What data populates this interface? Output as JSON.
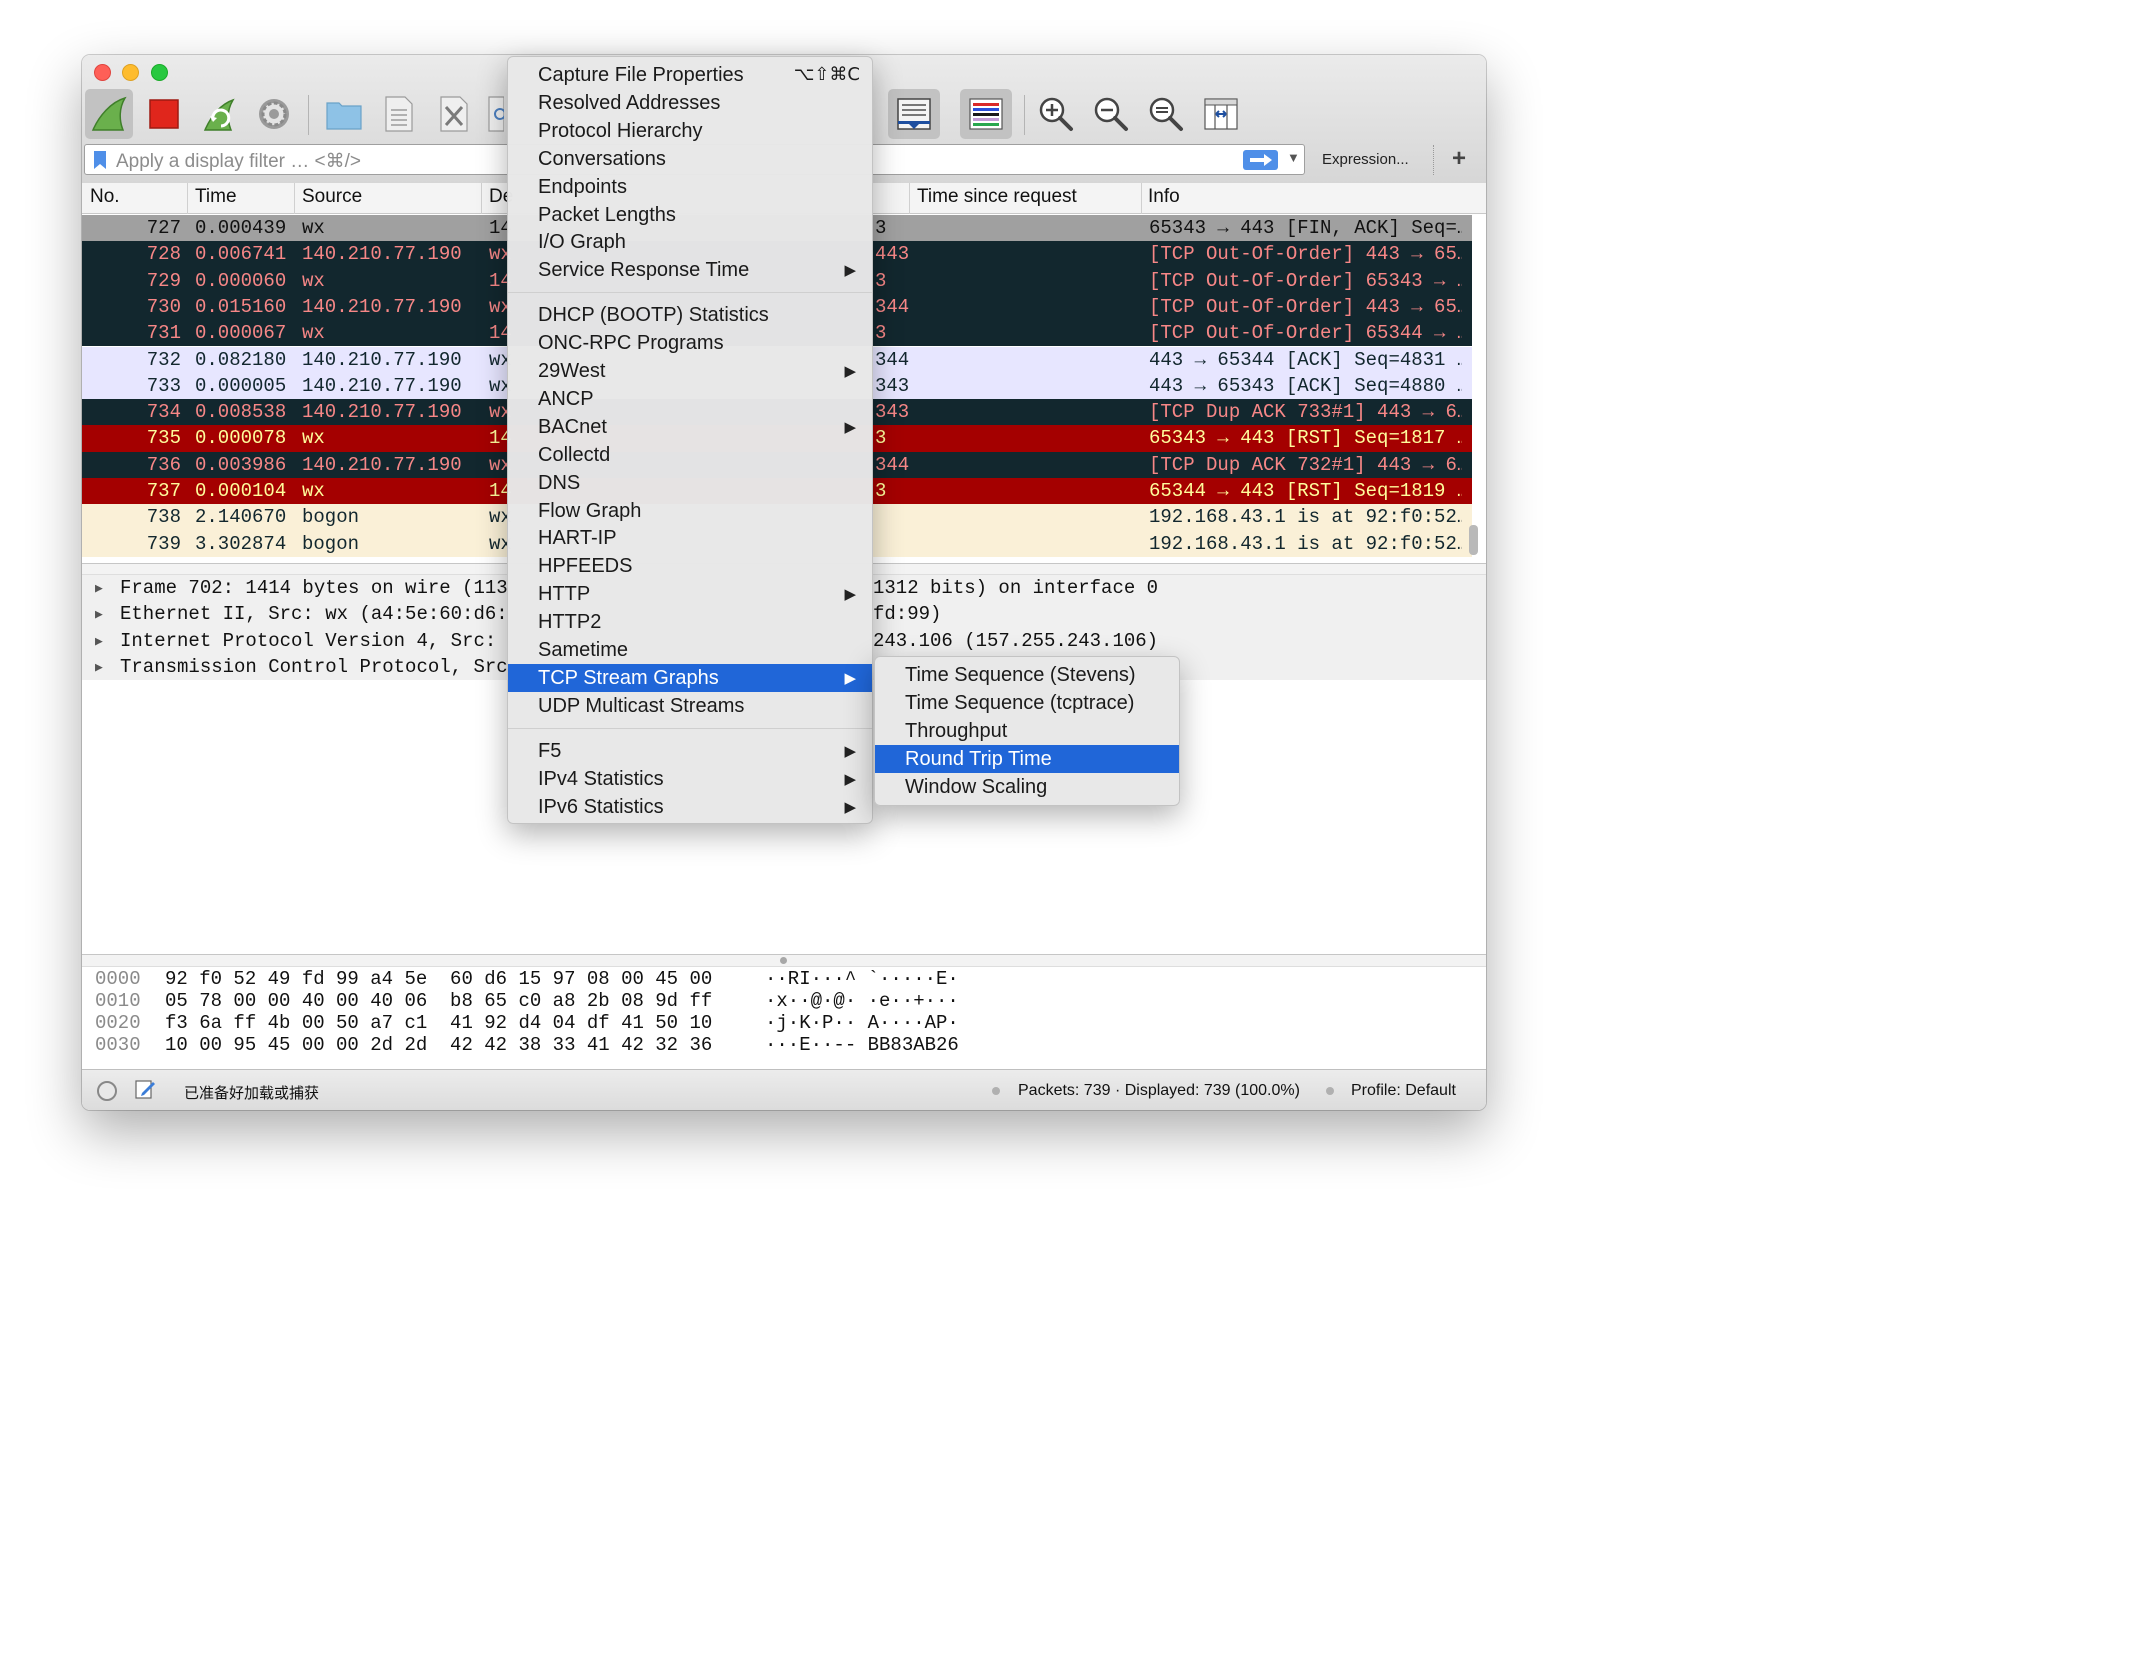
{
  "toolbar": {
    "icons": [
      "shark-fin-start-icon",
      "stop-capture-icon",
      "restart-capture-icon",
      "capture-options-icon",
      "open-file-icon",
      "save-file-icon",
      "close-file-icon",
      "reload-file-icon",
      "auto-scroll-icon",
      "colorize-icon",
      "zoom-in-icon",
      "zoom-out-icon",
      "zoom-normal-icon",
      "resize-columns-icon"
    ],
    "expression_label": "Expression...",
    "add_label": "+"
  },
  "filter": {
    "placeholder": "Apply a display filter … <⌘/>"
  },
  "columns": {
    "no": "No.",
    "time": "Time",
    "source": "Source",
    "destination": "De",
    "time_since_request": "Time since request",
    "info": "Info"
  },
  "packets": [
    {
      "no": "727",
      "time": "0.000439",
      "source": "wx",
      "dest": "14",
      "dest2": "3",
      "info": "65343 → 443 [FIN, ACK] Seq=…"
    },
    {
      "no": "728",
      "time": "0.006741",
      "source": "140.210.77.190",
      "dest": "wx",
      "dest2": "443",
      "info": "[TCP Out-Of-Order] 443 → 65…"
    },
    {
      "no": "729",
      "time": "0.000060",
      "source": "wx",
      "dest": "14",
      "dest2": "3",
      "info": "[TCP Out-Of-Order] 65343 → …"
    },
    {
      "no": "730",
      "time": "0.015160",
      "source": "140.210.77.190",
      "dest": "wx",
      "dest2": "344",
      "info": "[TCP Out-Of-Order] 443 → 65…"
    },
    {
      "no": "731",
      "time": "0.000067",
      "source": "wx",
      "dest": "14",
      "dest2": "3",
      "info": "[TCP Out-Of-Order] 65344 → …"
    },
    {
      "no": "732",
      "time": "0.082180",
      "source": "140.210.77.190",
      "dest": "wx",
      "dest2": "344",
      "info": "443 → 65344 [ACK] Seq=4831 …"
    },
    {
      "no": "733",
      "time": "0.000005",
      "source": "140.210.77.190",
      "dest": "wx",
      "dest2": "343",
      "info": "443 → 65343 [ACK] Seq=4880 …"
    },
    {
      "no": "734",
      "time": "0.008538",
      "source": "140.210.77.190",
      "dest": "wx",
      "dest2": "343",
      "info": "[TCP Dup ACK 733#1] 443 → 6…"
    },
    {
      "no": "735",
      "time": "0.000078",
      "source": "wx",
      "dest": "14",
      "dest2": "3",
      "info": "65343 → 443 [RST] Seq=1817 …"
    },
    {
      "no": "736",
      "time": "0.003986",
      "source": "140.210.77.190",
      "dest": "wx",
      "dest2": "344",
      "info": "[TCP Dup ACK 732#1] 443 → 6…"
    },
    {
      "no": "737",
      "time": "0.000104",
      "source": "wx",
      "dest": "14",
      "dest2": "3",
      "info": "65344 → 443 [RST] Seq=1819 …"
    },
    {
      "no": "738",
      "time": "2.140670",
      "source": "bogon",
      "dest": "wx",
      "dest2": "",
      "info": "192.168.43.1 is at 92:f0:52…"
    },
    {
      "no": "739",
      "time": "3.302874",
      "source": "bogon",
      "dest": "wx",
      "dest2": "",
      "info": "192.168.43.1 is at 92:f0:52…"
    }
  ],
  "row_styles": [
    {
      "bg": "#a0a0a0",
      "fg": "#111111"
    },
    {
      "bg": "#12272e",
      "fg": "#f78787"
    },
    {
      "bg": "#12272e",
      "fg": "#f78787"
    },
    {
      "bg": "#12272e",
      "fg": "#f78787"
    },
    {
      "bg": "#12272e",
      "fg": "#f78787"
    },
    {
      "bg": "#e7e6ff",
      "fg": "#12272e"
    },
    {
      "bg": "#e7e6ff",
      "fg": "#12272e"
    },
    {
      "bg": "#12272e",
      "fg": "#f78787"
    },
    {
      "bg": "#a40000",
      "fg": "#fffc9c"
    },
    {
      "bg": "#12272e",
      "fg": "#f78787"
    },
    {
      "bg": "#a40000",
      "fg": "#fffc9c"
    },
    {
      "bg": "#faf0d7",
      "fg": "#12272e"
    },
    {
      "bg": "#faf0d7",
      "fg": "#12272e"
    }
  ],
  "details": [
    {
      "left": "Frame 702: 1414 bytes on wire (113",
      "right": "1312 bits) on interface 0"
    },
    {
      "left": "Ethernet II, Src: wx (a4:5e:60:d6:",
      "right": "fd:99)"
    },
    {
      "left": "Internet Protocol Version 4, Src: ",
      "right": "243.106 (157.255.243.106)"
    },
    {
      "left": "Transmission Control Protocol, Src",
      "right": ""
    }
  ],
  "bytes": [
    {
      "offset": "0000",
      "hex": "92 f0 52 49 fd 99 a4 5e  60 d6 15 97 08 00 45 00",
      "ascii": "··RI···^ `·····E·"
    },
    {
      "offset": "0010",
      "hex": "05 78 00 00 40 00 40 06  b8 65 c0 a8 2b 08 9d ff",
      "ascii": "·x··@·@· ·e··+···"
    },
    {
      "offset": "0020",
      "hex": "f3 6a ff 4b 00 50 a7 c1  41 92 d4 04 df 41 50 10",
      "ascii": "·j·K·P·· A····AP·"
    },
    {
      "offset": "0030",
      "hex": "10 00 95 45 00 00 2d 2d  42 42 38 33 41 42 32 36",
      "ascii": "···E··-- BB83AB26"
    }
  ],
  "status": {
    "message": "已准备好加载或捕获",
    "packets": "Packets: 739 · Displayed: 739 (100.0%)",
    "profile": "Profile: Default"
  },
  "statistics_menu": {
    "items": [
      {
        "label": "Capture File Properties",
        "shortcut": "⌥⇧⌘C",
        "submenu": false
      },
      {
        "label": "Resolved Addresses",
        "submenu": false
      },
      {
        "label": "Protocol Hierarchy",
        "submenu": false
      },
      {
        "label": "Conversations",
        "submenu": false
      },
      {
        "label": "Endpoints",
        "submenu": false
      },
      {
        "label": "Packet Lengths",
        "submenu": false
      },
      {
        "label": "I/O Graph",
        "submenu": false
      },
      {
        "label": "Service Response Time",
        "submenu": true
      },
      {
        "separator": true
      },
      {
        "label": "DHCP (BOOTP) Statistics",
        "submenu": false
      },
      {
        "label": "ONC-RPC Programs",
        "submenu": false
      },
      {
        "label": "29West",
        "submenu": true
      },
      {
        "label": "ANCP",
        "submenu": false
      },
      {
        "label": "BACnet",
        "submenu": true
      },
      {
        "label": "Collectd",
        "submenu": false
      },
      {
        "label": "DNS",
        "submenu": false
      },
      {
        "label": "Flow Graph",
        "submenu": false
      },
      {
        "label": "HART-IP",
        "submenu": false
      },
      {
        "label": "HPFEEDS",
        "submenu": false
      },
      {
        "label": "HTTP",
        "submenu": true
      },
      {
        "label": "HTTP2",
        "submenu": false
      },
      {
        "label": "Sametime",
        "submenu": false
      },
      {
        "label": "TCP Stream Graphs",
        "submenu": true,
        "highlighted": true
      },
      {
        "label": "UDP Multicast Streams",
        "submenu": false
      },
      {
        "separator": true
      },
      {
        "label": "F5",
        "submenu": true
      },
      {
        "label": "IPv4 Statistics",
        "submenu": true
      },
      {
        "label": "IPv6 Statistics",
        "submenu": true
      }
    ]
  },
  "tcp_stream_graphs_submenu": {
    "items": [
      {
        "label": "Time Sequence (Stevens)"
      },
      {
        "label": "Time Sequence (tcptrace)"
      },
      {
        "label": "Throughput"
      },
      {
        "label": "Round Trip Time",
        "highlighted": true
      },
      {
        "label": "Window Scaling"
      }
    ]
  },
  "colors": {
    "menu_highlight": "#2066d8",
    "filter_apply": "#4f8fe8"
  }
}
